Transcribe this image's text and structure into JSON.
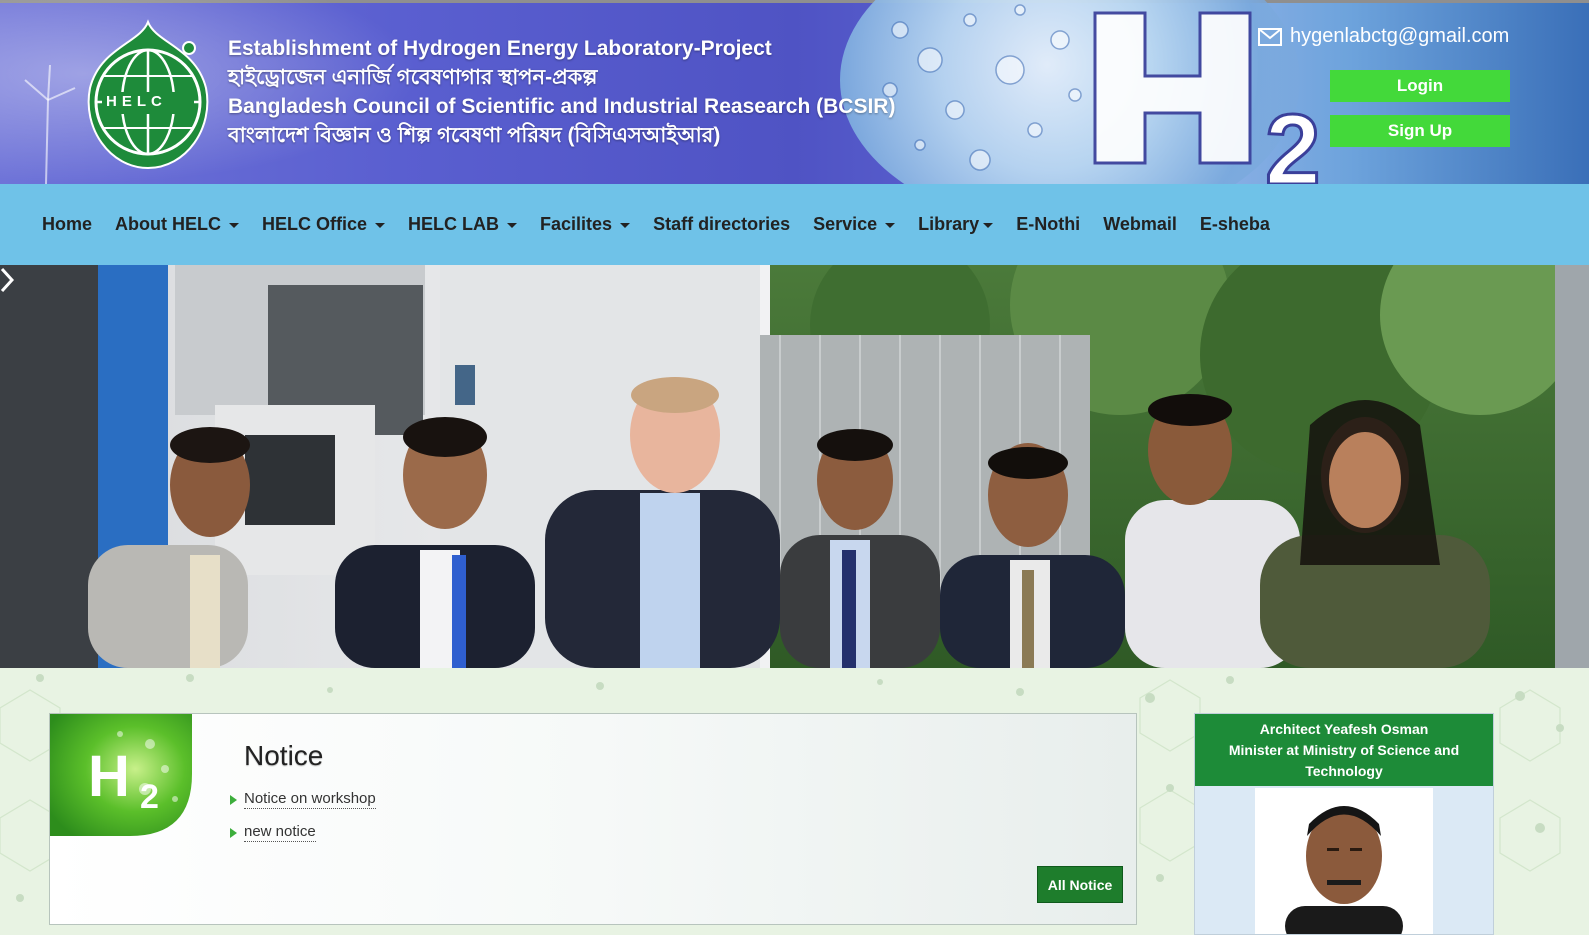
{
  "header": {
    "logo_text": "HELC",
    "title_lines": [
      "Establishment of Hydrogen Energy Laboratory-Project",
      "হাইড্রোজেন এনার্জি গবেষণাগার স্থাপন-প্রকল্প",
      "Bangladesh Council of Scientific and Industrial Reasearch (BCSIR)",
      "বাংলাদেশ বিজ্ঞান ও শিল্প গবেষণা পরিষদ (বিসিএসআইআর)"
    ],
    "email": "hygenlabctg@gmail.com",
    "login_label": "Login",
    "signup_label": "Sign Up",
    "h2_mark_icon": "h2-mark-icon"
  },
  "nav": {
    "items": [
      {
        "label": "Home",
        "dropdown": false
      },
      {
        "label": "About HELC",
        "dropdown": true
      },
      {
        "label": "HELC Office",
        "dropdown": true
      },
      {
        "label": "HELC LAB",
        "dropdown": true
      },
      {
        "label": "Facilites",
        "dropdown": true
      },
      {
        "label": "Staff directories",
        "dropdown": false
      },
      {
        "label": "Service",
        "dropdown": true
      },
      {
        "label": "Library",
        "dropdown": true
      },
      {
        "label": "E-Nothi",
        "dropdown": false
      },
      {
        "label": "Webmail",
        "dropdown": false
      },
      {
        "label": "E-sheba",
        "dropdown": false
      }
    ]
  },
  "notice": {
    "title": "Notice",
    "items": [
      "Notice on workshop",
      "new notice"
    ],
    "all_label": "All Notice"
  },
  "minister": {
    "name": "Architect Yeafesh Osman",
    "role": "Minister at Ministry of Science and Technology"
  },
  "colors": {
    "nav_bg": "#6fc2e8",
    "button_green": "#43d93a",
    "all_notice_green": "#1e7d2c",
    "minister_header": "#1d8b38"
  }
}
